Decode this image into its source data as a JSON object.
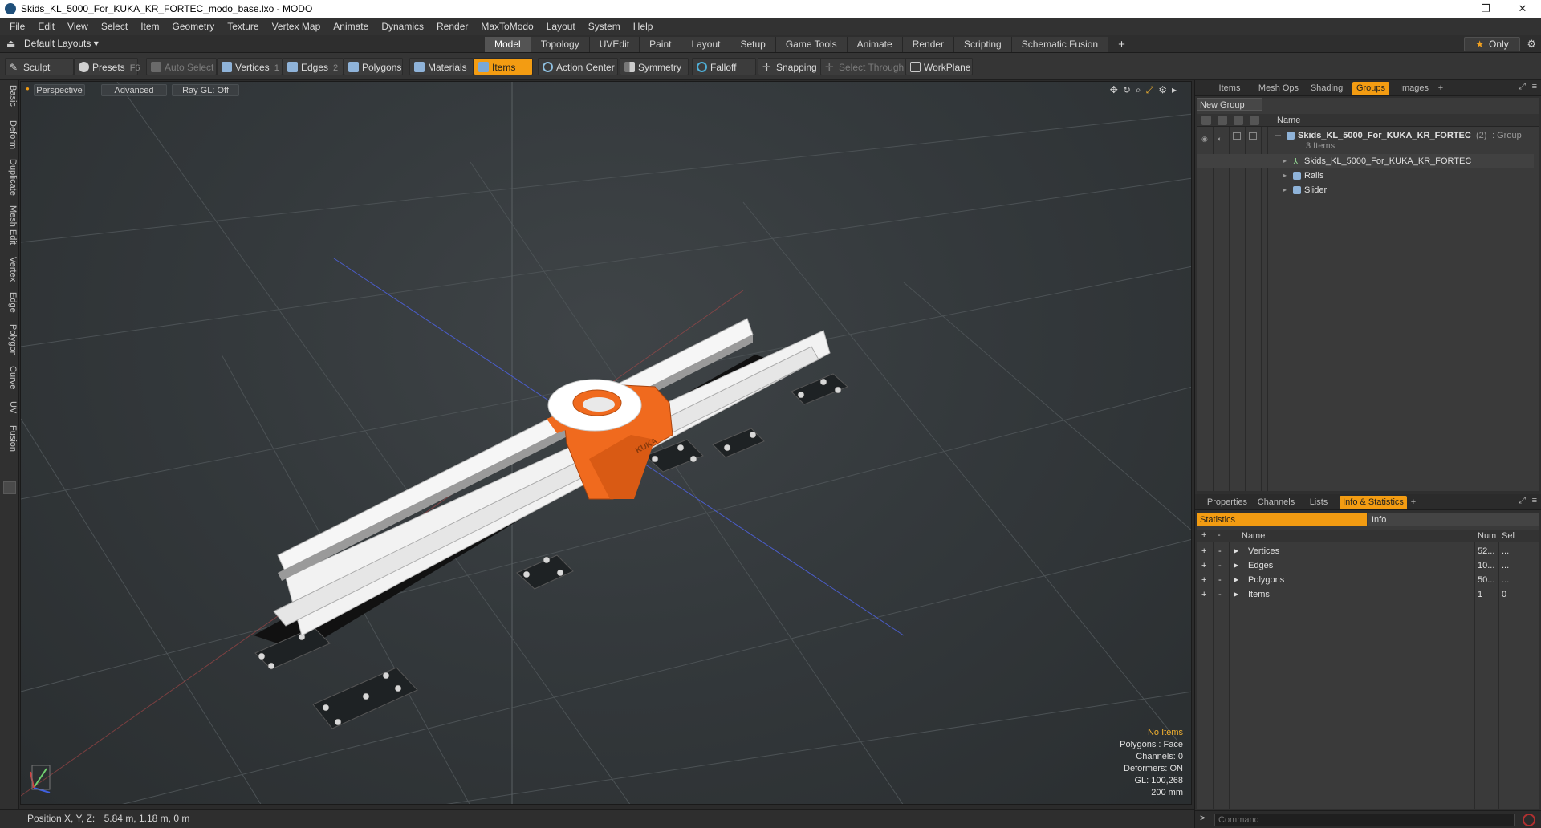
{
  "window": {
    "title": "Skids_KL_5000_For_KUKA_KR_FORTEC_modo_base.lxo - MODO",
    "minimize": "—",
    "maximize": "❐",
    "close": "✕"
  },
  "menu": [
    "File",
    "Edit",
    "View",
    "Select",
    "Item",
    "Geometry",
    "Texture",
    "Vertex Map",
    "Animate",
    "Dynamics",
    "Render",
    "MaxToModo",
    "Layout",
    "System",
    "Help"
  ],
  "layoutbar": {
    "layouts_label": "Default Layouts ▾",
    "tabs": [
      "Model",
      "Topology",
      "UVEdit",
      "Paint",
      "Layout",
      "Setup",
      "Game Tools",
      "Animate",
      "Render",
      "Scripting",
      "Schematic Fusion"
    ],
    "active_tab": "Model",
    "add_tab": "+",
    "only_label": "Only"
  },
  "toolbar": {
    "sculpt": "Sculpt",
    "presets": "Presets",
    "presets_key": "F6",
    "auto_select": "Auto Select",
    "vertices": "Vertices",
    "vertices_key": "1",
    "edges": "Edges",
    "edges_key": "2",
    "polygons": "Polygons",
    "materials": "Materials",
    "items": "Items",
    "action_center": "Action Center",
    "symmetry": "Symmetry",
    "falloff": "Falloff",
    "snapping": "Snapping",
    "select_through": "Select Through",
    "workplane": "WorkPlane"
  },
  "left_tabs": [
    "Basic",
    "Deform",
    "Duplicate",
    "Mesh Edit",
    "Vertex",
    "Edge",
    "Polygon",
    "Curve",
    "UV",
    "Fusion"
  ],
  "viewport": {
    "view_mode": "Perspective",
    "shading": "Advanced",
    "raygl": "Ray GL: Off",
    "kuka_label": "KUKA",
    "hud": {
      "selection": "No Items",
      "polygons": "Polygons : Face",
      "channels": "Channels: 0",
      "deformers": "Deformers: ON",
      "gl": "GL: 100,268",
      "scale": "200 mm"
    }
  },
  "statusbar": {
    "position_label": "Position X, Y, Z:",
    "position_value": "5.84 m, 1.18 m, 0 m"
  },
  "groups_panel": {
    "tabs": [
      "Items",
      "Mesh Ops",
      "Shading",
      "Groups",
      "Images"
    ],
    "active_tab": "Groups",
    "new_group": "New Group",
    "name_header": "Name",
    "group": {
      "name": "Skids_KL_5000_For_KUKA_KR_FORTEC",
      "count": "(2)",
      "type": ": Group",
      "items_count": "3 Items"
    },
    "children": [
      "Skids_KL_5000_For_KUKA_KR_FORTEC",
      "Rails",
      "Slider"
    ]
  },
  "stats_panel": {
    "tabs": [
      "Properties",
      "Channels",
      "Lists",
      "Info & Statistics"
    ],
    "active_tab": "Info & Statistics",
    "sub_tabs": [
      "Statistics",
      "Info"
    ],
    "headers": {
      "name": "Name",
      "num": "Num",
      "sel": "Sel"
    },
    "rows": [
      {
        "name": "Vertices",
        "num": "52...",
        "sel": "..."
      },
      {
        "name": "Edges",
        "num": "10...",
        "sel": "..."
      },
      {
        "name": "Polygons",
        "num": "50...",
        "sel": "..."
      },
      {
        "name": "Items",
        "num": "1",
        "sel": "0"
      }
    ]
  },
  "command": {
    "prompt": ">",
    "placeholder": "Command"
  },
  "colors": {
    "accent": "#f39c12",
    "kuka_orange": "#f06a1e",
    "rail_white": "#f2f2f2"
  }
}
